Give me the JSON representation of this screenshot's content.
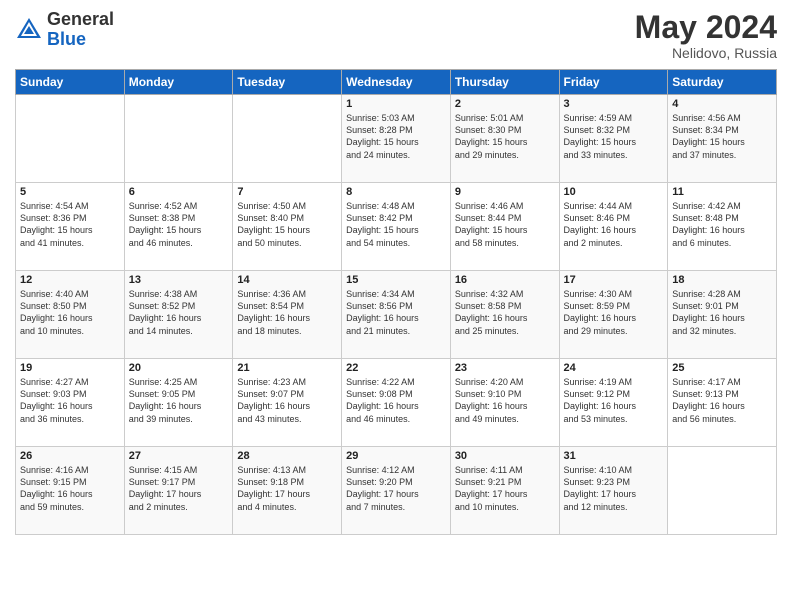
{
  "header": {
    "logo_general": "General",
    "logo_blue": "Blue",
    "month_year": "May 2024",
    "location": "Nelidovo, Russia"
  },
  "weekdays": [
    "Sunday",
    "Monday",
    "Tuesday",
    "Wednesday",
    "Thursday",
    "Friday",
    "Saturday"
  ],
  "weeks": [
    [
      {
        "day": "",
        "info": ""
      },
      {
        "day": "",
        "info": ""
      },
      {
        "day": "",
        "info": ""
      },
      {
        "day": "1",
        "info": "Sunrise: 5:03 AM\nSunset: 8:28 PM\nDaylight: 15 hours\nand 24 minutes."
      },
      {
        "day": "2",
        "info": "Sunrise: 5:01 AM\nSunset: 8:30 PM\nDaylight: 15 hours\nand 29 minutes."
      },
      {
        "day": "3",
        "info": "Sunrise: 4:59 AM\nSunset: 8:32 PM\nDaylight: 15 hours\nand 33 minutes."
      },
      {
        "day": "4",
        "info": "Sunrise: 4:56 AM\nSunset: 8:34 PM\nDaylight: 15 hours\nand 37 minutes."
      }
    ],
    [
      {
        "day": "5",
        "info": "Sunrise: 4:54 AM\nSunset: 8:36 PM\nDaylight: 15 hours\nand 41 minutes."
      },
      {
        "day": "6",
        "info": "Sunrise: 4:52 AM\nSunset: 8:38 PM\nDaylight: 15 hours\nand 46 minutes."
      },
      {
        "day": "7",
        "info": "Sunrise: 4:50 AM\nSunset: 8:40 PM\nDaylight: 15 hours\nand 50 minutes."
      },
      {
        "day": "8",
        "info": "Sunrise: 4:48 AM\nSunset: 8:42 PM\nDaylight: 15 hours\nand 54 minutes."
      },
      {
        "day": "9",
        "info": "Sunrise: 4:46 AM\nSunset: 8:44 PM\nDaylight: 15 hours\nand 58 minutes."
      },
      {
        "day": "10",
        "info": "Sunrise: 4:44 AM\nSunset: 8:46 PM\nDaylight: 16 hours\nand 2 minutes."
      },
      {
        "day": "11",
        "info": "Sunrise: 4:42 AM\nSunset: 8:48 PM\nDaylight: 16 hours\nand 6 minutes."
      }
    ],
    [
      {
        "day": "12",
        "info": "Sunrise: 4:40 AM\nSunset: 8:50 PM\nDaylight: 16 hours\nand 10 minutes."
      },
      {
        "day": "13",
        "info": "Sunrise: 4:38 AM\nSunset: 8:52 PM\nDaylight: 16 hours\nand 14 minutes."
      },
      {
        "day": "14",
        "info": "Sunrise: 4:36 AM\nSunset: 8:54 PM\nDaylight: 16 hours\nand 18 minutes."
      },
      {
        "day": "15",
        "info": "Sunrise: 4:34 AM\nSunset: 8:56 PM\nDaylight: 16 hours\nand 21 minutes."
      },
      {
        "day": "16",
        "info": "Sunrise: 4:32 AM\nSunset: 8:58 PM\nDaylight: 16 hours\nand 25 minutes."
      },
      {
        "day": "17",
        "info": "Sunrise: 4:30 AM\nSunset: 8:59 PM\nDaylight: 16 hours\nand 29 minutes."
      },
      {
        "day": "18",
        "info": "Sunrise: 4:28 AM\nSunset: 9:01 PM\nDaylight: 16 hours\nand 32 minutes."
      }
    ],
    [
      {
        "day": "19",
        "info": "Sunrise: 4:27 AM\nSunset: 9:03 PM\nDaylight: 16 hours\nand 36 minutes."
      },
      {
        "day": "20",
        "info": "Sunrise: 4:25 AM\nSunset: 9:05 PM\nDaylight: 16 hours\nand 39 minutes."
      },
      {
        "day": "21",
        "info": "Sunrise: 4:23 AM\nSunset: 9:07 PM\nDaylight: 16 hours\nand 43 minutes."
      },
      {
        "day": "22",
        "info": "Sunrise: 4:22 AM\nSunset: 9:08 PM\nDaylight: 16 hours\nand 46 minutes."
      },
      {
        "day": "23",
        "info": "Sunrise: 4:20 AM\nSunset: 9:10 PM\nDaylight: 16 hours\nand 49 minutes."
      },
      {
        "day": "24",
        "info": "Sunrise: 4:19 AM\nSunset: 9:12 PM\nDaylight: 16 hours\nand 53 minutes."
      },
      {
        "day": "25",
        "info": "Sunrise: 4:17 AM\nSunset: 9:13 PM\nDaylight: 16 hours\nand 56 minutes."
      }
    ],
    [
      {
        "day": "26",
        "info": "Sunrise: 4:16 AM\nSunset: 9:15 PM\nDaylight: 16 hours\nand 59 minutes."
      },
      {
        "day": "27",
        "info": "Sunrise: 4:15 AM\nSunset: 9:17 PM\nDaylight: 17 hours\nand 2 minutes."
      },
      {
        "day": "28",
        "info": "Sunrise: 4:13 AM\nSunset: 9:18 PM\nDaylight: 17 hours\nand 4 minutes."
      },
      {
        "day": "29",
        "info": "Sunrise: 4:12 AM\nSunset: 9:20 PM\nDaylight: 17 hours\nand 7 minutes."
      },
      {
        "day": "30",
        "info": "Sunrise: 4:11 AM\nSunset: 9:21 PM\nDaylight: 17 hours\nand 10 minutes."
      },
      {
        "day": "31",
        "info": "Sunrise: 4:10 AM\nSunset: 9:23 PM\nDaylight: 17 hours\nand 12 minutes."
      },
      {
        "day": "",
        "info": ""
      }
    ]
  ]
}
